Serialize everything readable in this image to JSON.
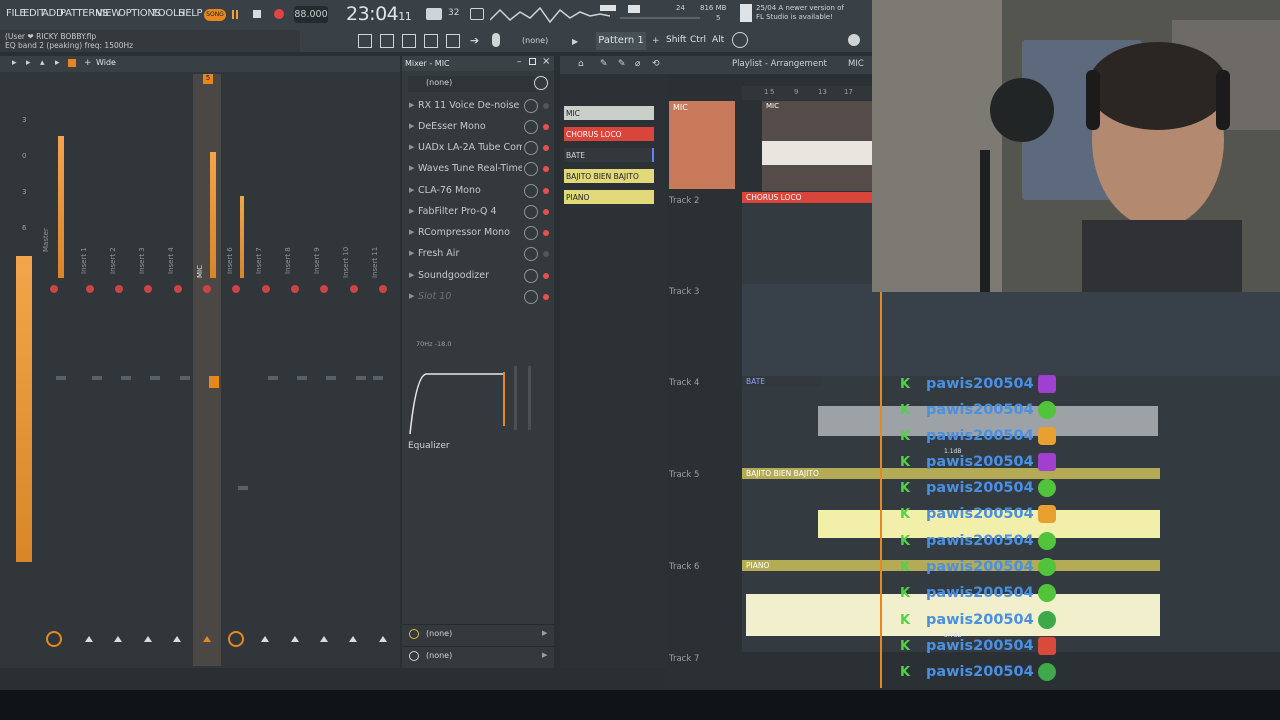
{
  "menu": [
    "FILE",
    "EDIT",
    "ADD",
    "PATTERNS",
    "VIEW",
    "OPTIONS",
    "TOOLS",
    "HELP"
  ],
  "song_badge": "SONG",
  "tempo": "88.000",
  "clock": "23:04",
  "clock_sec": "11",
  "mem": "816 MB",
  "cpu": "24",
  "voices": "5",
  "news": {
    "date": "25/04",
    "text1": "A newer version of",
    "text2": "FL Studio is available!"
  },
  "hint": {
    "user": "(User ❤",
    "project": "RICKY BOBBY.flp",
    "text": "EQ band 2 (peaking) freq: 1500Hz"
  },
  "toolbar": {
    "none_label": "(none)",
    "pattern": "Pattern 1",
    "shift": "Shift",
    "ctrl": "Ctrl",
    "alt": "Alt"
  },
  "mixer": {
    "title": "Mixer - MIC",
    "wide": "Wide",
    "tracks": [
      "Master",
      "Insert 1",
      "Insert 2",
      "Insert 3",
      "Insert 4",
      "MIC",
      "Insert 6",
      "Insert 7",
      "Insert 8",
      "Insert 9",
      "Insert 10",
      "Insert 11"
    ],
    "scale": [
      "3",
      "0",
      "3",
      "6"
    ],
    "selected_number": "5",
    "preset": "(none)",
    "slots": [
      "RX 11 Voice De-noise",
      "DeEsser Mono",
      "UADx LA-2A Tube Comp",
      "Waves Tune Real-Time",
      "CLA-76 Mono",
      "FabFilter Pro-Q 4",
      "RCompressor Mono",
      "Fresh Air",
      "Soundgoodizer",
      "Slot 10"
    ],
    "eq_readout": "70Hz -18.0",
    "eq_label": "Equalizer",
    "out1": "(none)",
    "out2": "(none)"
  },
  "rack": {
    "patterns": [
      {
        "name": "MIC",
        "color": "#c9cfc9"
      },
      {
        "name": "CHORUS LOCO",
        "color": "#d9443b"
      },
      {
        "name": "BATE",
        "color": "#33383c"
      },
      {
        "name": "BAJITO BIEN BAJITO",
        "color": "#e1d97a"
      },
      {
        "name": "PIANO",
        "color": "#e1d97a"
      }
    ]
  },
  "playlist": {
    "title": "Playlist - Arrangement",
    "crumb": "MIC",
    "ruler": [
      "1",
      "5",
      "9",
      "13",
      "17"
    ],
    "tracks": [
      "Track 2",
      "Track 3",
      "Track 4",
      "Track 5",
      "Track 6",
      "Track 7"
    ],
    "clips": {
      "mic": "MIC",
      "mic_head": "MIC",
      "chorus": "CHORUS LOCO",
      "bate": "BATE",
      "bajito": "BAJITO BIEN BAJITO",
      "piano": "PIANO"
    },
    "gain_labels": [
      "1.1dB",
      "3.7dB"
    ]
  },
  "chat": {
    "username": "pawis200504",
    "emotes": [
      "purple-invader",
      "green-sprout",
      "shiba",
      "purple-invader",
      "green-sprout",
      "shiba",
      "green-sprout",
      "green-sprout",
      "green-sprout",
      "green-frog",
      "red-angry",
      "green-frog",
      "green-frog"
    ]
  }
}
